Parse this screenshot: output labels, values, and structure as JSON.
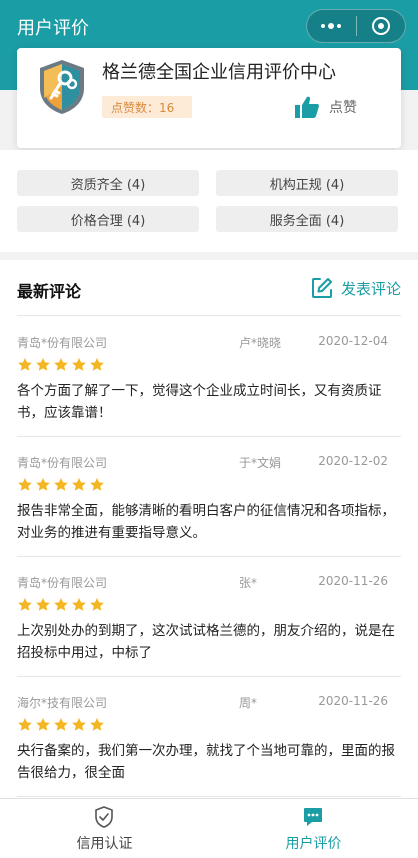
{
  "header": {
    "title": "用户评价"
  },
  "org": {
    "name": "格兰德全国企业信用评价中心",
    "likes_label": "点赞数：16",
    "like_button_label": "点赞"
  },
  "tags": [
    {
      "label": "资质齐全 (4)"
    },
    {
      "label": "机构正规 (4)"
    },
    {
      "label": "价格合理 (4)"
    },
    {
      "label": "服务全面 (4)"
    }
  ],
  "reviews_section": {
    "title": "最新评论",
    "post_label": "发表评论",
    "items": [
      {
        "company": "青岛*份有限公司",
        "user": "卢*晓晓",
        "date": "2020-12-04",
        "rating": 5,
        "content": "各个方面了解了一下，觉得这个企业成立时间长，又有资质证书，应该靠谱！"
      },
      {
        "company": "青岛*份有限公司",
        "user": "于*文娟",
        "date": "2020-12-02",
        "rating": 5,
        "content": "报告非常全面，能够清晰的看明白客户的征信情况和各项指标，对业务的推进有重要指导意义。"
      },
      {
        "company": "青岛*份有限公司",
        "user": "张*",
        "date": "2020-11-26",
        "rating": 5,
        "content": "上次别处办的到期了，这次试试格兰德的，朋友介绍的，说是在招投标中用过，中标了"
      },
      {
        "company": "海尔*技有限公司",
        "user": "周*",
        "date": "2020-11-26",
        "rating": 5,
        "content": "央行备案的，我们第一次办理，就找了个当地可靠的，里面的报告很给力，很全面"
      }
    ]
  },
  "tabbar": {
    "tabs": [
      {
        "label": "信用认证",
        "icon": "shield-check-icon"
      },
      {
        "label": "用户评价",
        "icon": "chat-bubble-icon"
      }
    ]
  },
  "colors": {
    "accent": "#1a9da5",
    "star": "#f5b623",
    "badge_bg": "#fdebd8",
    "badge_text": "#d98a3c"
  }
}
